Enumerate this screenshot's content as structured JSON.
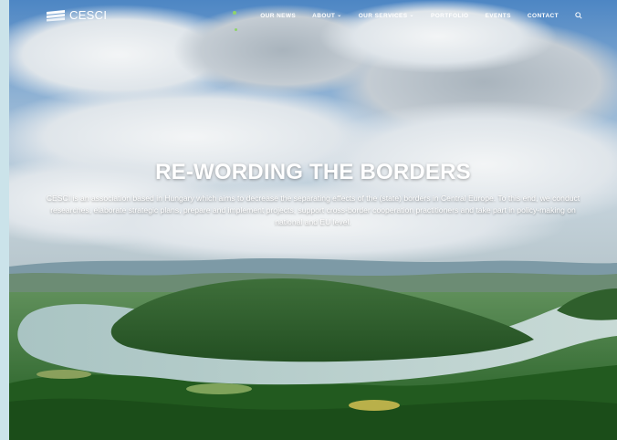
{
  "brand": {
    "name": "CESCI",
    "logo_icon": "cesci-logo-icon"
  },
  "nav": {
    "items": [
      {
        "label": "OUR NEWS",
        "has_dropdown": false
      },
      {
        "label": "ABOUT",
        "has_dropdown": true
      },
      {
        "label": "OUR SERVICES",
        "has_dropdown": true
      },
      {
        "label": "PORTFOLIO",
        "has_dropdown": false
      },
      {
        "label": "EVENTS",
        "has_dropdown": false
      },
      {
        "label": "CONTACT",
        "has_dropdown": false
      }
    ],
    "dropdown_glyph": "⌄",
    "search_icon": "search-icon"
  },
  "hero": {
    "title": "RE-WORDING THE BORDERS",
    "description": "CESCI is an association based in Hungary which aims to decrease the separating effects of the (state) borders in Central Europe. To this end, we conduct researches, elaborate strategic plans, prepare and implement projects, support cross-border cooperation practitioners and take part in policy-making on national and EU level."
  },
  "colors": {
    "frame": "#cbe3ea",
    "sky_top": "#5b8fc8",
    "cloud": "#e9eef2",
    "river": "#b9cfd0",
    "forest": "#2d6a2a",
    "accent": "#8fd36a",
    "text": "#ffffff"
  }
}
